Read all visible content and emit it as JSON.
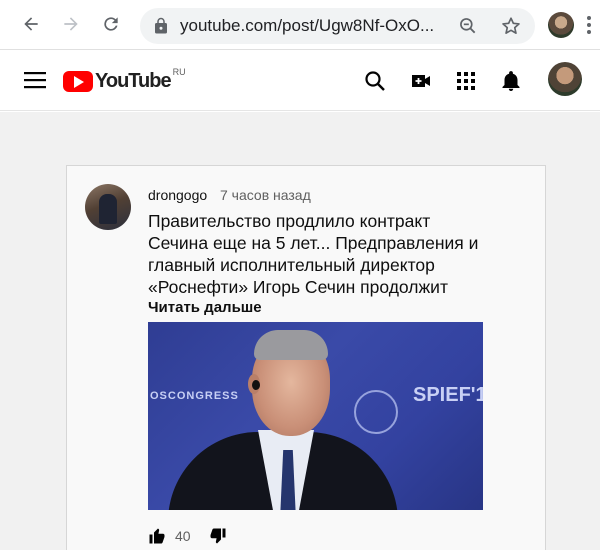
{
  "browser": {
    "url": "youtube.com/post/Ugw8Nf-OxO..."
  },
  "header": {
    "logo_word": "YouTube",
    "region": "RU"
  },
  "post": {
    "author": "drongogo",
    "time": "7 часов назад",
    "text": "Правительство продлило контракт Сечина еще на 5 лет... Предправления и главный исполнительный директор «Роснефти» Игорь Сечин продолжит",
    "read_more": "Читать дальше",
    "image_text_left": "OSCONGRESS",
    "image_text_right": "SPIEF'1",
    "likes": "40"
  },
  "colors": {
    "brand_red": "#ff0000",
    "text_primary": "#0f0f0f",
    "text_secondary": "#606060"
  },
  "icons": [
    "back-icon",
    "forward-icon",
    "reload-icon",
    "lock-icon",
    "zoom-icon",
    "star-icon",
    "menu-icon",
    "search-icon",
    "create-video-icon",
    "apps-icon",
    "notifications-icon",
    "like-icon",
    "dislike-icon"
  ]
}
